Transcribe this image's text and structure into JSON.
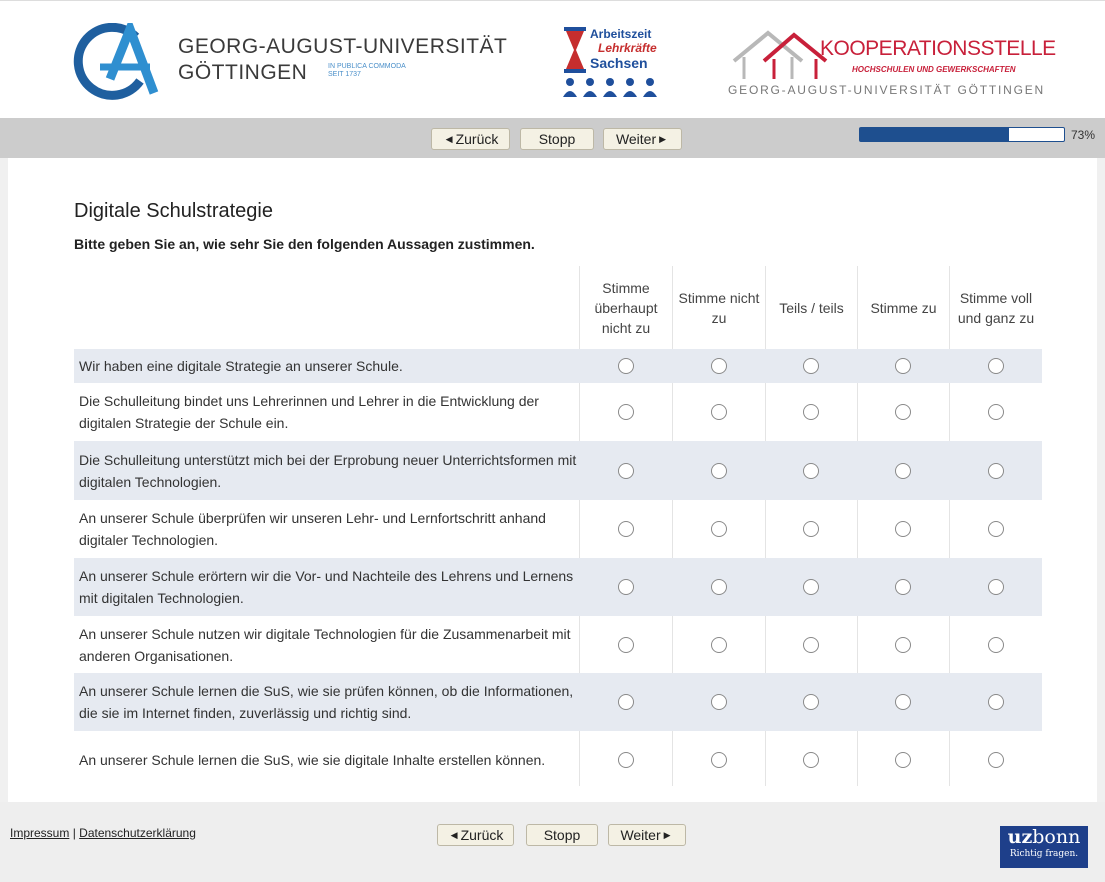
{
  "header": {
    "university_name_line1": "GEORG-AUGUST-UNIVERSITÄT",
    "university_name_line2": "GÖTTINGEN",
    "university_motto_line1": "IN PUBLICA COMMODA",
    "university_motto_line2": "SEIT 1737",
    "saxony_line1": "Arbeitszeit",
    "saxony_line2": "Lehrkräfte",
    "saxony_line3": "Sachsen",
    "koop_title": "KOOPERATIONSSTELLE",
    "koop_subtitle": "HOCHSCHULEN UND GEWERKSCHAFTEN",
    "koop_footer": "GEORG-AUGUST-UNIVERSITÄT GÖTTINGEN"
  },
  "nav": {
    "back_label": "Zurück",
    "stop_label": "Stopp",
    "next_label": "Weiter",
    "progress_percent": 73,
    "progress_label": "73%"
  },
  "survey": {
    "title": "Digitale Schulstrategie",
    "instruction": "Bitte geben Sie an, wie sehr Sie den folgenden Aussagen zustimmen.",
    "columns": [
      "Stimme überhaupt nicht zu",
      "Stimme nicht zu",
      "Teils / teils",
      "Stimme zu",
      "Stimme voll und ganz zu"
    ],
    "statements": [
      "Wir haben eine digitale Strategie an unserer Schule.",
      "Die Schulleitung bindet uns Lehrerinnen und Lehrer in die Entwicklung der digitalen Strategie der Schule ein.",
      "Die Schulleitung unterstützt mich bei der Erprobung neuer Unterrichtsformen mit digitalen Technologien.",
      "An unserer Schule überprüfen wir unseren Lehr- und Lernfortschritt anhand digitaler Technologien.",
      "An unserer Schule erörtern wir die Vor- und Nachteile des Lehrens und Lernens mit digitalen Technologien.",
      "An unserer Schule nutzen wir digitale Technologien für die Zusammenarbeit mit anderen Organisationen.",
      "An unserer Schule lernen die SuS, wie sie prüfen können, ob die Informationen, die sie im Internet finden, zuverlässig und richtig sind.",
      "An unserer Schule lernen die SuS, wie sie digitale Inhalte erstellen können."
    ]
  },
  "footer": {
    "impressum_label": "Impressum",
    "separator": "|",
    "privacy_label": "Datenschutzerklärung",
    "back_label": "Zurück",
    "stop_label": "Stopp",
    "next_label": "Weiter",
    "uzbonn_bold": "uz",
    "uzbonn_rest": "bonn",
    "uzbonn_tagline": "Richtig fragen."
  },
  "colors": {
    "accent": "#1e4f8f",
    "row_shade": "#e6eaf1",
    "nav_bar": "#cccccc",
    "button_bg": "#f4f1e4",
    "koop_red": "#c8203a",
    "uni_blue": "#2f73b5"
  },
  "icons": {
    "back": "triangle-left-icon",
    "next": "triangle-right-icon",
    "radio": "radio-empty-icon"
  }
}
